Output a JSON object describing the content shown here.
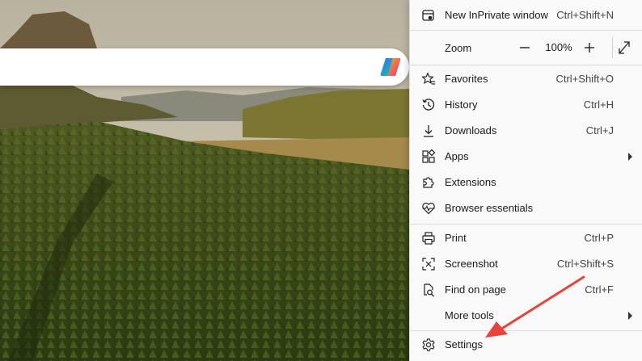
{
  "menu": {
    "inprivate": {
      "label": "New InPrivate window",
      "shortcut": "Ctrl+Shift+N",
      "icon": "inprivate-window-icon"
    },
    "zoom": {
      "label": "Zoom",
      "value": "100%",
      "minus_icon": "minus-icon",
      "plus_icon": "plus-icon",
      "fullscreen_icon": "fullscreen-icon"
    },
    "items": [
      {
        "label": "Favorites",
        "shortcut": "Ctrl+Shift+O",
        "icon": "favorites-star-icon"
      },
      {
        "label": "History",
        "shortcut": "Ctrl+H",
        "icon": "history-icon"
      },
      {
        "label": "Downloads",
        "shortcut": "Ctrl+J",
        "icon": "download-icon"
      },
      {
        "label": "Apps",
        "shortcut": "",
        "icon": "apps-icon",
        "submenu": true
      },
      {
        "label": "Extensions",
        "shortcut": "",
        "icon": "extensions-puzzle-icon"
      },
      {
        "label": "Browser essentials",
        "shortcut": "",
        "icon": "heart-pulse-icon"
      },
      {
        "label": "Print",
        "shortcut": "Ctrl+P",
        "icon": "printer-icon"
      },
      {
        "label": "Screenshot",
        "shortcut": "Ctrl+Shift+S",
        "icon": "screenshot-icon"
      },
      {
        "label": "Find on page",
        "shortcut": "Ctrl+F",
        "icon": "find-on-page-icon"
      },
      {
        "label": "More tools",
        "shortcut": "",
        "icon": "",
        "submenu": true
      },
      {
        "label": "Settings",
        "shortcut": "",
        "icon": "gear-icon"
      }
    ]
  },
  "colors": {
    "annotation_arrow": "#e5443a",
    "menu_bg": "#f9f9f9",
    "divider": "#dcdcdc"
  },
  "background": {
    "icon": "copilot-icon"
  }
}
